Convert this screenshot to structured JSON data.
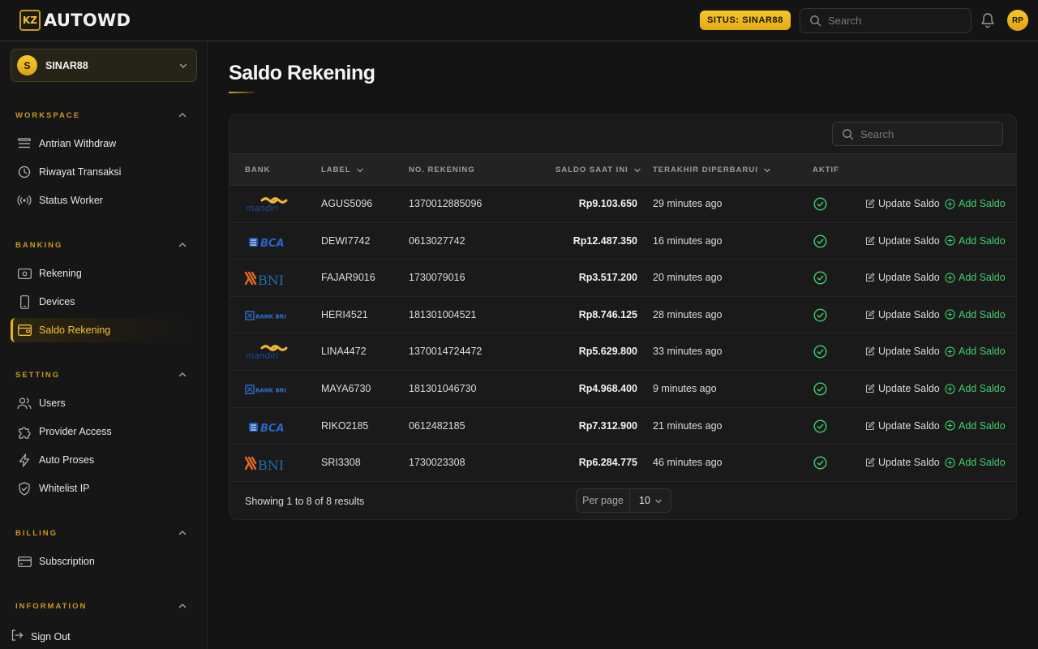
{
  "app": {
    "name": "AUTOWD",
    "logo_mark": "KZ"
  },
  "topbar": {
    "situs_label": "SITUS: SINAR88",
    "search_placeholder": "Search",
    "avatar_initials": "RP"
  },
  "workspace": {
    "initial": "S",
    "name": "SINAR88"
  },
  "sidebar": {
    "sections": {
      "workspace": "WORKSPACE",
      "banking": "BANKING",
      "setting": "SETTING",
      "billing": "BILLING",
      "information": "INFORMATION"
    },
    "items": {
      "antrian_withdraw": "Antrian Withdraw",
      "riwayat_transaksi": "Riwayat Transaksi",
      "status_worker": "Status Worker",
      "rekening": "Rekening",
      "devices": "Devices",
      "saldo_rekening": "Saldo Rekening",
      "users": "Users",
      "provider_access": "Provider Access",
      "auto_proses": "Auto Proses",
      "whitelist_ip": "Whitelist IP",
      "subscription": "Subscription",
      "sign_out": "Sign Out"
    },
    "active_item": "saldo_rekening"
  },
  "page": {
    "title": "Saldo Rekening"
  },
  "table": {
    "search_placeholder": "Search",
    "headers": {
      "bank": "BANK",
      "label": "LABEL",
      "no_rekening": "NO. REKENING",
      "saldo": "SALDO SAAT INI",
      "terakhir": "TERAKHIR DIPERBARUI",
      "aktif": "AKTIF"
    },
    "actions": {
      "update": "Update Saldo",
      "add": "Add Saldo"
    },
    "rows": [
      {
        "bank": "mandiri",
        "bank_text": "mandiri",
        "label": "AGUS5096",
        "no_rekening": "1370012885096",
        "saldo": "Rp9.103.650",
        "updated": "29 minutes ago",
        "aktif": true
      },
      {
        "bank": "bca",
        "bank_text": "BCA",
        "label": "DEWI7742",
        "no_rekening": "0613027742",
        "saldo": "Rp12.487.350",
        "updated": "16 minutes ago",
        "aktif": true
      },
      {
        "bank": "bni",
        "bank_text": "BNI",
        "label": "FAJAR9016",
        "no_rekening": "1730079016",
        "saldo": "Rp3.517.200",
        "updated": "20 minutes ago",
        "aktif": true
      },
      {
        "bank": "bri",
        "bank_text": "BANK BRI",
        "label": "HERI4521",
        "no_rekening": "181301004521",
        "saldo": "Rp8.746.125",
        "updated": "28 minutes ago",
        "aktif": true
      },
      {
        "bank": "mandiri",
        "bank_text": "mandiri",
        "label": "LINA4472",
        "no_rekening": "1370014724472",
        "saldo": "Rp5.629.800",
        "updated": "33 minutes ago",
        "aktif": true
      },
      {
        "bank": "bri",
        "bank_text": "BANK BRI",
        "label": "MAYA6730",
        "no_rekening": "181301046730",
        "saldo": "Rp4.968.400",
        "updated": "9 minutes ago",
        "aktif": true
      },
      {
        "bank": "bca",
        "bank_text": "BCA",
        "label": "RIKO2185",
        "no_rekening": "0612482185",
        "saldo": "Rp7.312.900",
        "updated": "21 minutes ago",
        "aktif": true
      },
      {
        "bank": "bni",
        "bank_text": "BNI",
        "label": "SRI3308",
        "no_rekening": "1730023308",
        "saldo": "Rp6.284.775",
        "updated": "46 minutes ago",
        "aktif": true
      }
    ],
    "footer": {
      "showing": "Showing 1 to 8 of 8 results",
      "per_page_label": "Per page",
      "per_page_value": "10"
    }
  },
  "colors": {
    "accent": "#f4c531",
    "success": "#3fcf6e",
    "background": "#131313"
  }
}
